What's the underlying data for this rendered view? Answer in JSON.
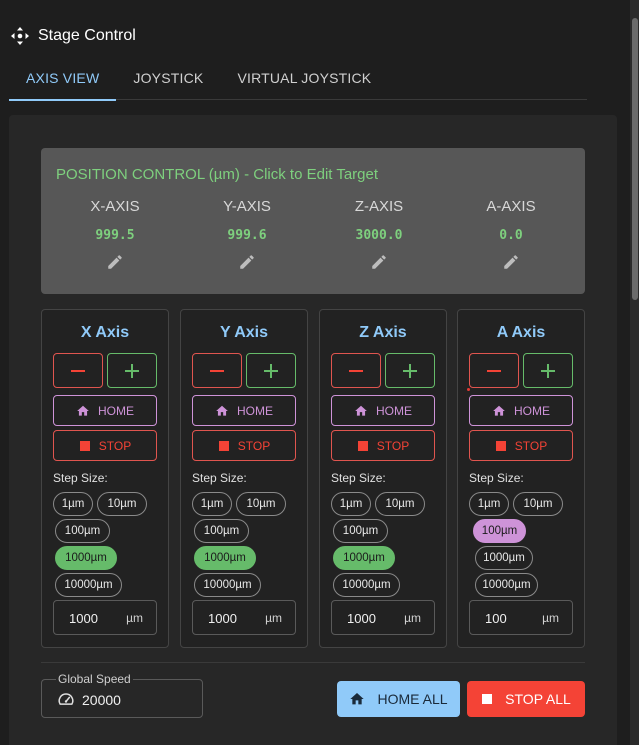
{
  "app": {
    "title": "Stage Control",
    "icon": "move-arrows-icon"
  },
  "tabs": [
    {
      "label": "AXIS VIEW",
      "active": true
    },
    {
      "label": "JOYSTICK",
      "active": false
    },
    {
      "label": "VIRTUAL JOYSTICK",
      "active": false
    }
  ],
  "position": {
    "title": "POSITION CONTROL (µm) - Click to Edit Target",
    "axes": [
      {
        "name": "X-AXIS",
        "value": "999.5"
      },
      {
        "name": "Y-AXIS",
        "value": "999.6"
      },
      {
        "name": "Z-AXIS",
        "value": "3000.0"
      },
      {
        "name": "A-AXIS",
        "value": "0.0"
      }
    ]
  },
  "axis_cards": [
    {
      "title": "X Axis",
      "home": "HOME",
      "stop": "STOP",
      "step_label": "Step Size:",
      "steps": [
        "1µm",
        "10µm",
        "100µm",
        "1000µm",
        "10000µm"
      ],
      "selected_step": "1000µm",
      "step_value": "1000",
      "unit": "µm"
    },
    {
      "title": "Y Axis",
      "home": "HOME",
      "stop": "STOP",
      "step_label": "Step Size:",
      "steps": [
        "1µm",
        "10µm",
        "100µm",
        "1000µm",
        "10000µm"
      ],
      "selected_step": "1000µm",
      "step_value": "1000",
      "unit": "µm"
    },
    {
      "title": "Z Axis",
      "home": "HOME",
      "stop": "STOP",
      "step_label": "Step Size:",
      "steps": [
        "1µm",
        "10µm",
        "100µm",
        "1000µm",
        "10000µm"
      ],
      "selected_step": "1000µm",
      "step_value": "1000",
      "unit": "µm"
    },
    {
      "title": "A Axis",
      "home": "HOME",
      "stop": "STOP",
      "step_label": "Step Size:",
      "steps": [
        "1µm",
        "10µm",
        "100µm",
        "1000µm",
        "10000µm"
      ],
      "selected_step": "100µm",
      "step_value": "100",
      "unit": "µm"
    }
  ],
  "global": {
    "speed_label": "Global Speed",
    "speed_value": "20000",
    "home_all": "HOME ALL",
    "stop_all": "STOP ALL"
  },
  "colors": {
    "accent_blue": "#90caf9",
    "green": "#66bb6a",
    "red": "#f44336",
    "purple": "#ce93d8",
    "bg": "#1e1e1e"
  }
}
